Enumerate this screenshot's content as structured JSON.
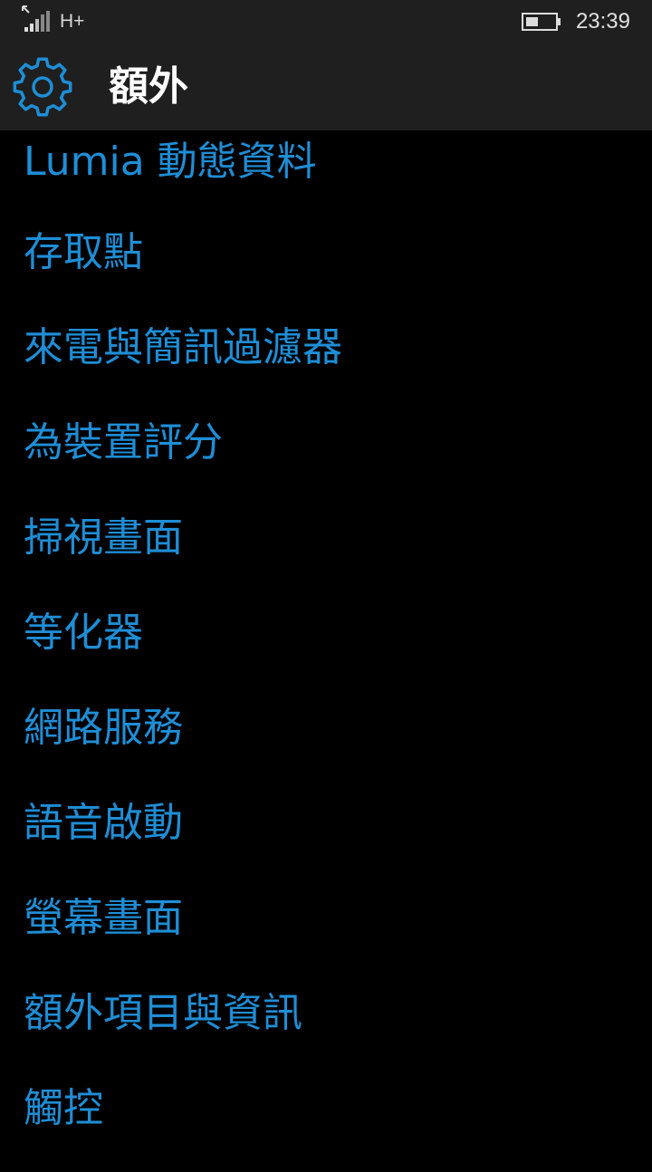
{
  "status_bar": {
    "network_type": "H+",
    "time": "23:39"
  },
  "header": {
    "title": "額外",
    "icon": "gear-icon"
  },
  "menu": [
    "Lumia 動態資料",
    "存取點",
    "來電與簡訊過濾器",
    "為裝置評分",
    "掃視畫面",
    "等化器",
    "網路服務",
    "語音啟動",
    "螢幕畫面",
    "額外項目與資訊",
    "觸控"
  ],
  "colors": {
    "accent": "#1e8ed6",
    "chrome": "#1f1f1f",
    "background": "#000000"
  }
}
